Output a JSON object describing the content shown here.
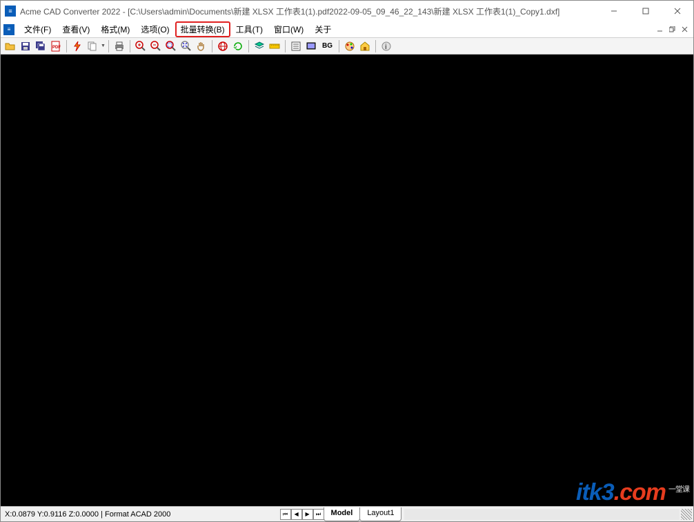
{
  "titlebar": {
    "app_name": "Acme CAD Converter 2022",
    "document_path": "[C:\\Users\\admin\\Documents\\新建 XLSX 工作表1(1).pdf2022-09-05_09_46_22_143\\新建 XLSX 工作表1(1)_Copy1.dxf]"
  },
  "menu": {
    "items": [
      {
        "label": "文件(F)",
        "highlighted": false
      },
      {
        "label": "查看(V)",
        "highlighted": false
      },
      {
        "label": "格式(M)",
        "highlighted": false
      },
      {
        "label": "选项(O)",
        "highlighted": false
      },
      {
        "label": "批量转换(B)",
        "highlighted": true
      },
      {
        "label": "工具(T)",
        "highlighted": false
      },
      {
        "label": "窗口(W)",
        "highlighted": false
      },
      {
        "label": "关于",
        "highlighted": false
      }
    ]
  },
  "toolbar": {
    "icons": [
      "open",
      "save",
      "save-all",
      "pdf",
      "convert",
      "copy",
      "paste",
      "print",
      "zoom-in",
      "zoom-out",
      "zoom-window",
      "zoom-extents",
      "pan",
      "zoom-all",
      "redraw",
      "layers",
      "measure",
      "properties",
      "fullscreen",
      "bg",
      "color-map",
      "home",
      "help"
    ],
    "bg_label": "BG"
  },
  "status": {
    "coords": "X:0.0879 Y:0.9116 Z:0.0000",
    "format": "Format ACAD 2000",
    "tabs": [
      {
        "label": "Model",
        "active": true
      },
      {
        "label": "Layout1",
        "active": false
      }
    ]
  },
  "watermark": {
    "brand": "itk3",
    "tld": "com",
    "tagline_cn": "一堂课"
  }
}
